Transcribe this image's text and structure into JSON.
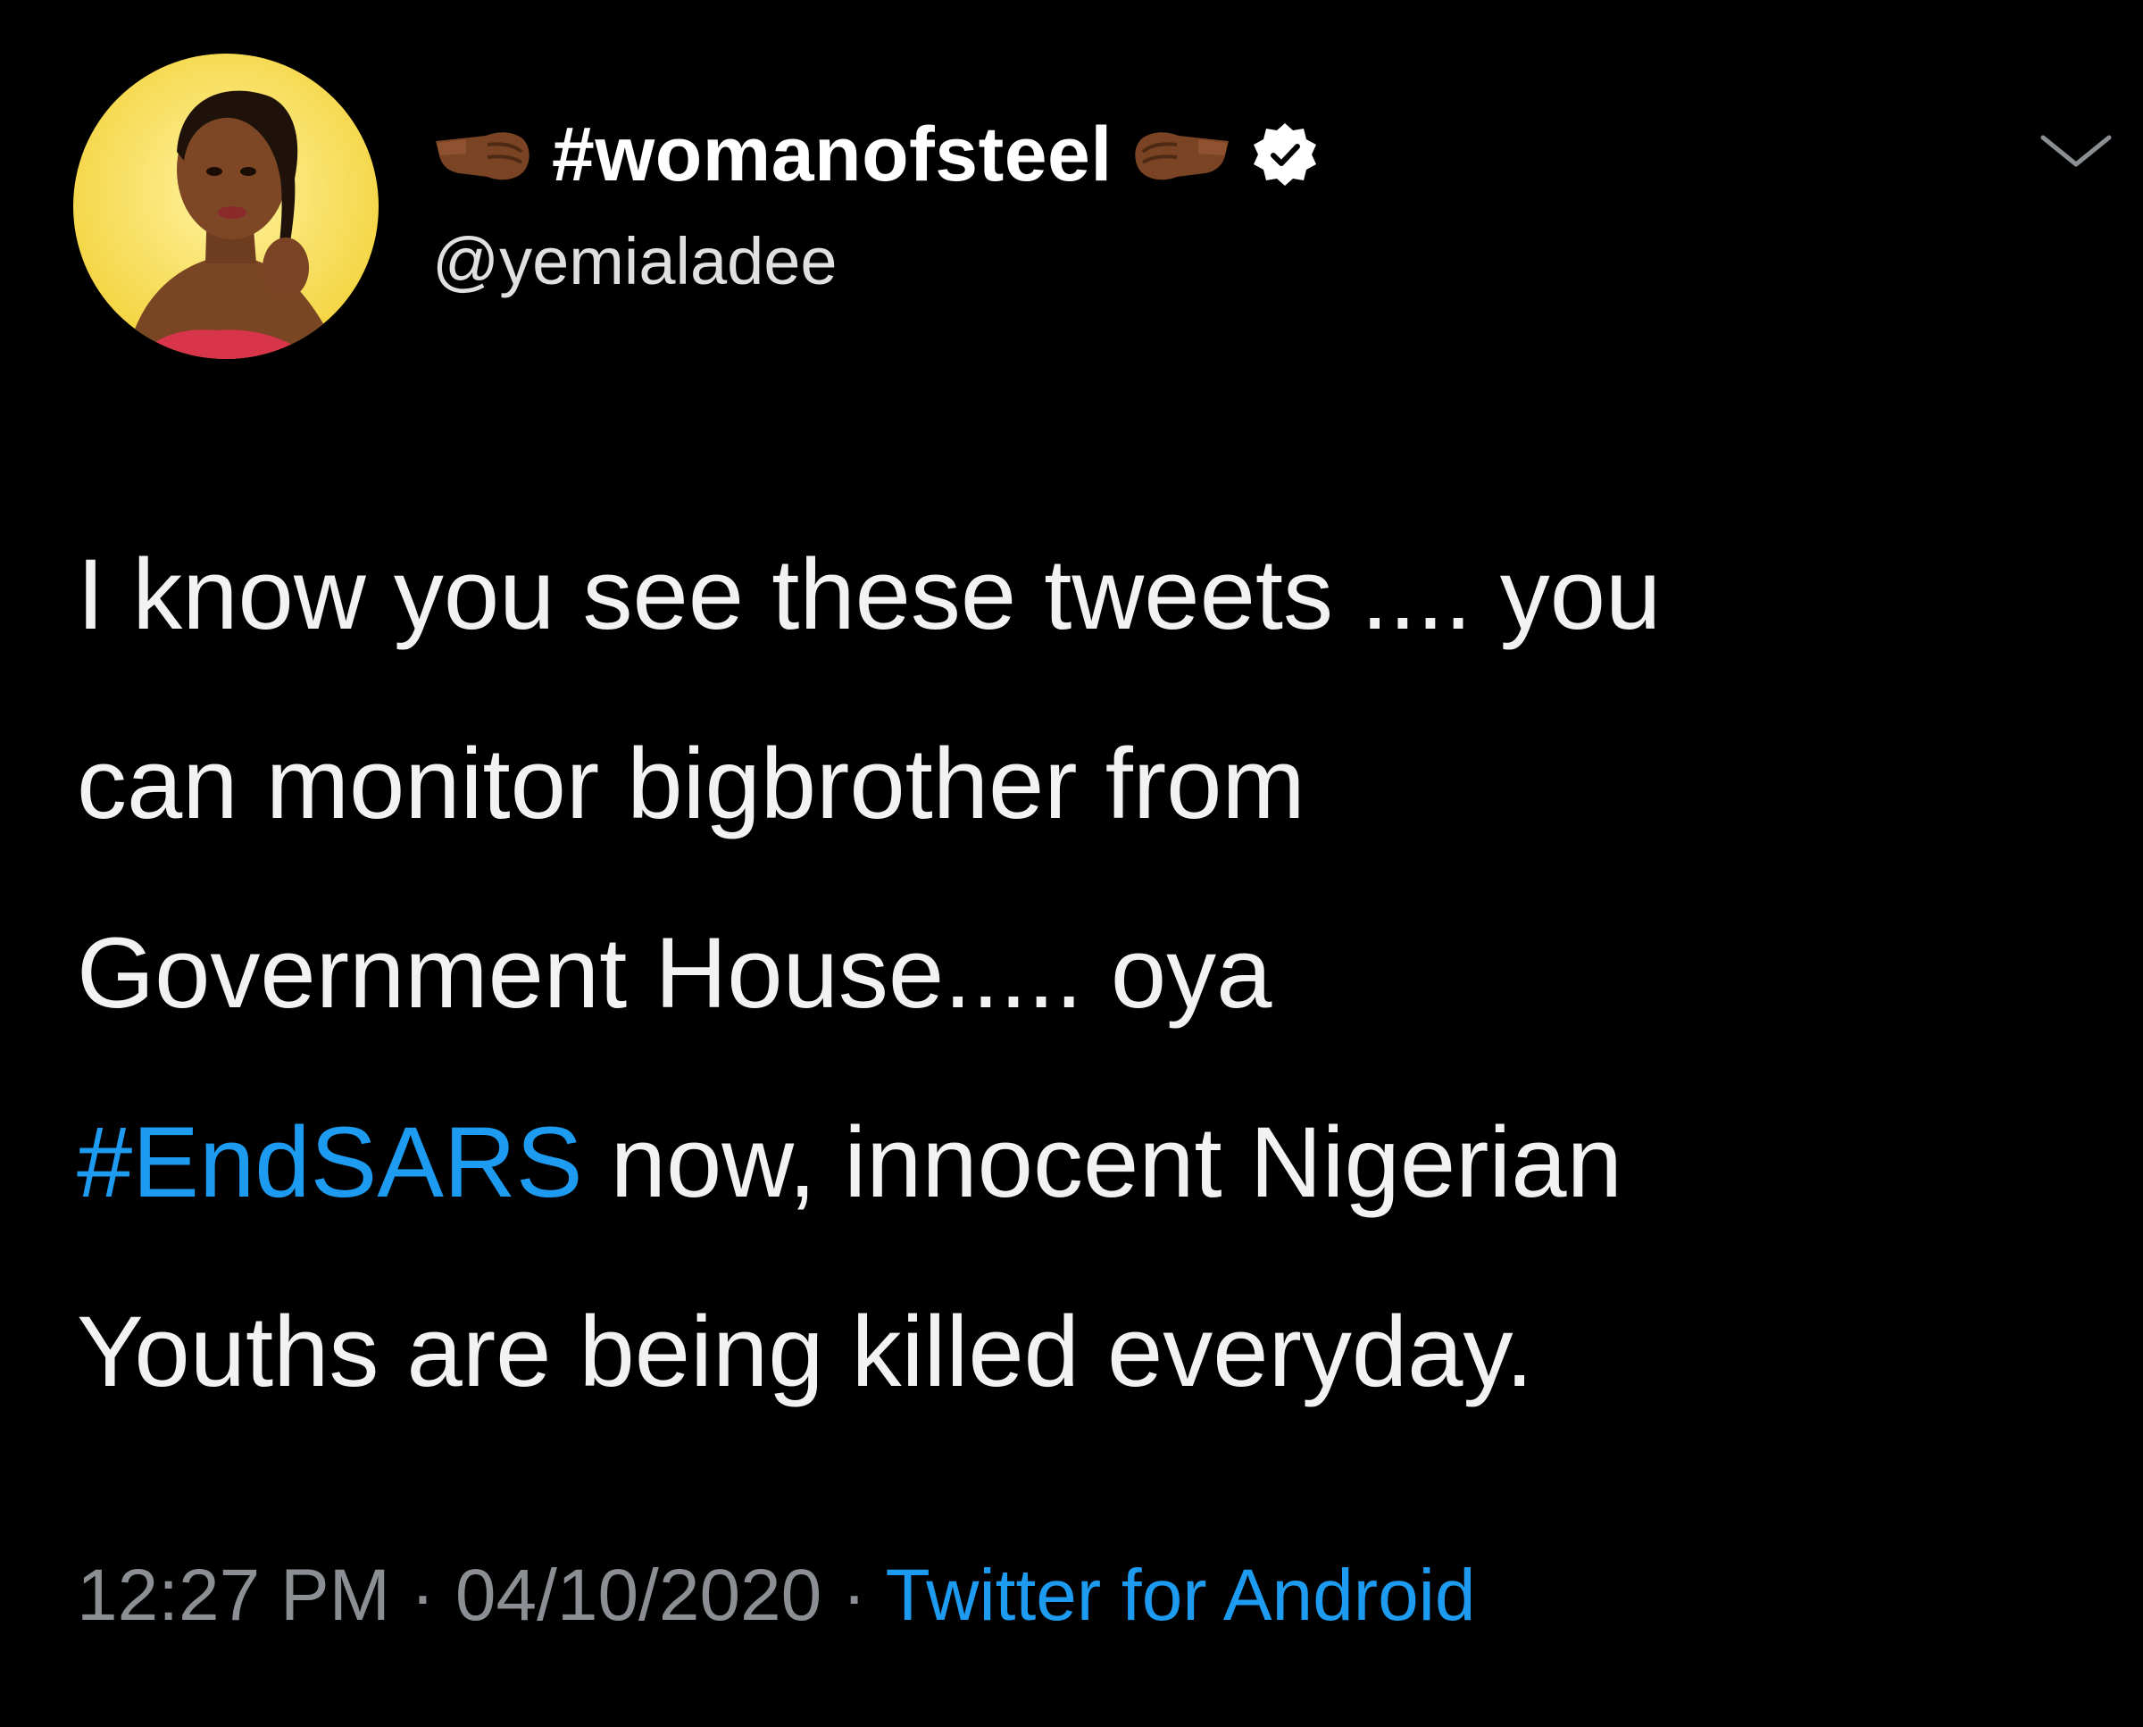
{
  "tweet": {
    "display_name": "#womanofsteel",
    "handle": "@yemialadee",
    "body": {
      "line1": "I know you see these tweets .... you",
      "line2": "can monitor bigbrother from",
      "line3": "Government House..... oya",
      "line4_hashtag": "#EndSARS",
      "line4_rest": " now, innocent Nigerian",
      "line5": "Youths are being killed everyday."
    },
    "meta": {
      "time": "12:27 PM",
      "date": "04/10/2020",
      "source": "Twitter for Android",
      "separator": " · "
    }
  },
  "icons": {
    "avatar": "profile-photo",
    "left_fist": "left-facing-fist-icon",
    "right_fist": "right-facing-fist-icon",
    "verified": "verified-badge-icon",
    "menu": "chevron-down-icon"
  },
  "colors": {
    "background": "#000000",
    "text": "#f2f2f2",
    "link": "#1d9bf0",
    "muted": "#8b8f93"
  }
}
